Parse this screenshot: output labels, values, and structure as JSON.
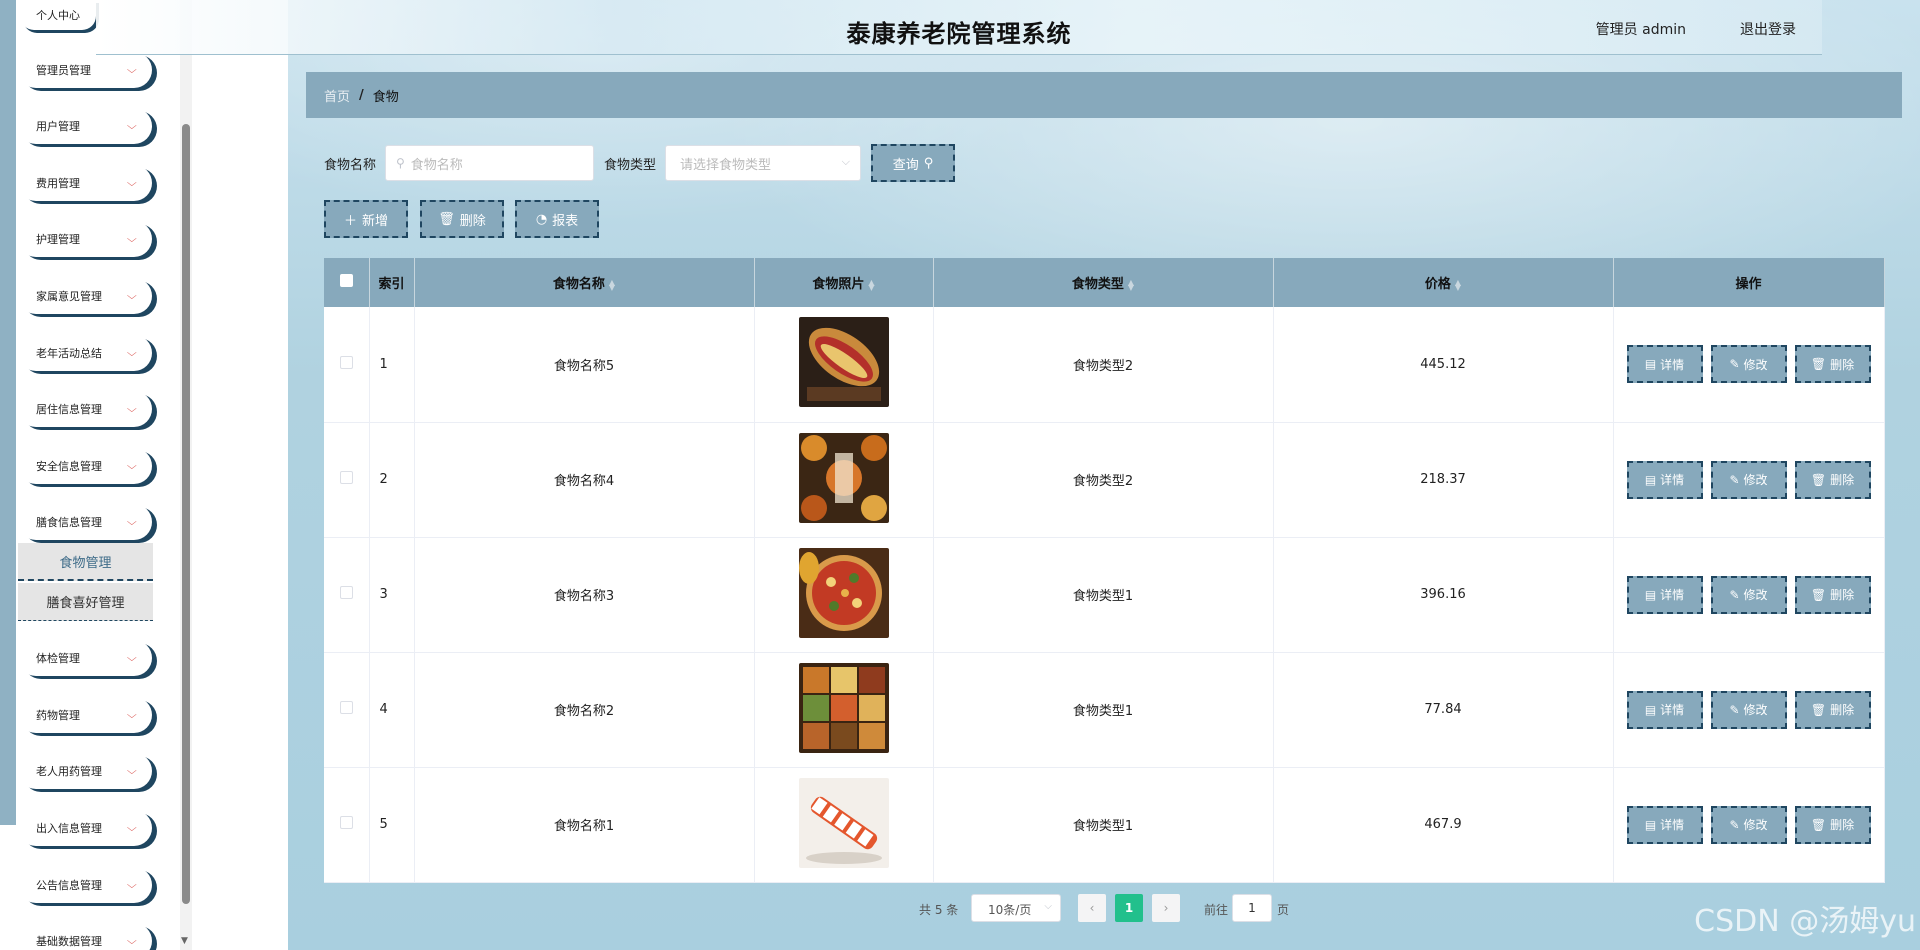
{
  "header": {
    "title": "泰康养老院管理系统",
    "user": "管理员 admin",
    "logout": "退出登录"
  },
  "sidebar": {
    "top_item": "个人中心",
    "items": [
      {
        "label": "管理员管理"
      },
      {
        "label": "用户管理"
      },
      {
        "label": "费用管理"
      },
      {
        "label": "护理管理"
      },
      {
        "label": "家属意见管理"
      },
      {
        "label": "老年活动总结"
      },
      {
        "label": "居住信息管理"
      },
      {
        "label": "安全信息管理"
      },
      {
        "label": "膳食信息管理"
      },
      {
        "label": "体检管理"
      },
      {
        "label": "药物管理"
      },
      {
        "label": "老人用药管理"
      },
      {
        "label": "出入信息管理"
      },
      {
        "label": "公告信息管理"
      },
      {
        "label": "基础数据管理"
      }
    ],
    "submenu": [
      {
        "label": "食物管理",
        "active": true
      },
      {
        "label": "膳食喜好管理",
        "active": false
      }
    ]
  },
  "breadcrumb": {
    "home": "首页",
    "separator": "/",
    "current": "食物"
  },
  "search": {
    "name_label": "食物名称",
    "name_placeholder": "食物名称",
    "type_label": "食物类型",
    "type_placeholder": "请选择食物类型",
    "query_label": "查询"
  },
  "actions": {
    "add": "新增",
    "delete": "删除",
    "report": "报表"
  },
  "table": {
    "columns": [
      "索引",
      "食物名称",
      "食物照片",
      "食物类型",
      "价格",
      "操作"
    ],
    "rows": [
      {
        "index": "1",
        "name": "食物名称5",
        "type": "食物类型2",
        "price": "445.12",
        "image": "sandwich"
      },
      {
        "index": "2",
        "name": "食物名称4",
        "type": "食物类型2",
        "price": "218.37",
        "image": "assorted-dishes"
      },
      {
        "index": "3",
        "name": "食物名称3",
        "type": "食物类型1",
        "price": "396.16",
        "image": "pizza"
      },
      {
        "index": "4",
        "name": "食物名称2",
        "type": "食物类型1",
        "price": "77.84",
        "image": "bento-box"
      },
      {
        "index": "5",
        "name": "食物名称1",
        "type": "食物类型1",
        "price": "467.9",
        "image": "sushi-roll"
      }
    ],
    "row_actions": {
      "detail": "详情",
      "edit": "修改",
      "delete": "删除"
    }
  },
  "pagination": {
    "total": "共 5 条",
    "page_size": "10条/页",
    "current_page": "1",
    "goto_label": "前往",
    "goto_value": "1",
    "page_suffix": "页"
  },
  "watermark": "CSDN @汤姆yu",
  "colors": {
    "accent": "#87a9bc",
    "border_dark": "#1f4660",
    "pager_active": "#22c08c"
  }
}
